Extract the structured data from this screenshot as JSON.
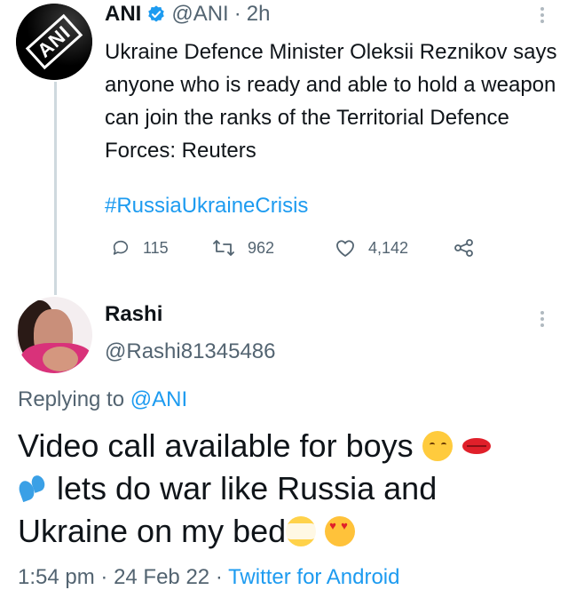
{
  "original_tweet": {
    "author_name": "ANI",
    "handle": "@ANI",
    "separator": "·",
    "time": "2h",
    "text": "Ukraine Defence Minister Oleksii Reznikov says anyone who is ready and able to hold a weapon can join the ranks of the Territorial Defence Forces: Reuters",
    "hashtag": "#RussiaUkraineCrisis",
    "replies_count": "115",
    "retweets_count": "962",
    "likes_count": "4,142",
    "avatar_logo_text": "ANI"
  },
  "reply_tweet": {
    "author_name": "Rashi",
    "handle": "@Rashi81345486",
    "replying_label": "Replying to",
    "replying_to": "@ANI",
    "text_line1": "Video call available for boys",
    "text_line2": "lets  do war like Russia and",
    "text_line3_part1": "Ukraine on  my bed",
    "timestamp": "1:54 pm",
    "date": "24 Feb 22",
    "separator": "·",
    "source": "Twitter for Android"
  },
  "colors": {
    "link_blue": "#1d9bf0",
    "secondary_text": "#536471",
    "primary_text": "#0f1419"
  },
  "icons": [
    "verified-badge-icon",
    "more-options-icon",
    "reply-icon",
    "retweet-icon",
    "like-icon",
    "share-icon"
  ]
}
